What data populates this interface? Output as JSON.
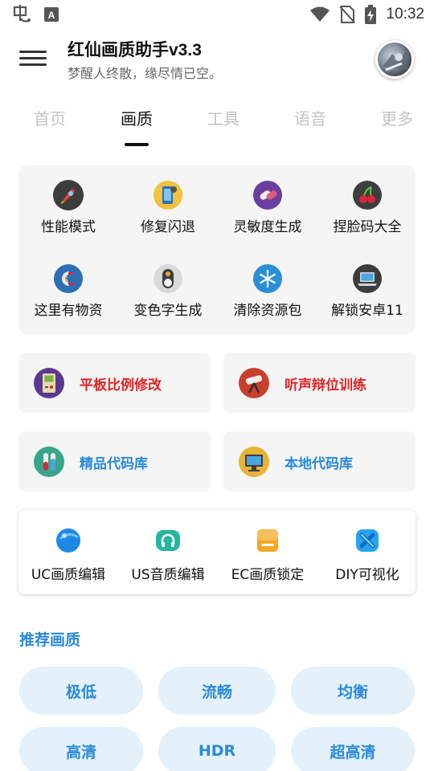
{
  "status_bar": {
    "time": "10:32",
    "icons": [
      "app-notification-icon",
      "font-notification-icon",
      "wifi-icon",
      "no-sim-icon",
      "battery-charging-icon"
    ]
  },
  "header": {
    "title": "红仙画质助手v3.3",
    "subtitle": "梦醒人终散，缘尽情已空。"
  },
  "tabs": [
    {
      "label": "首页",
      "active": false
    },
    {
      "label": "画质",
      "active": true
    },
    {
      "label": "工具",
      "active": false
    },
    {
      "label": "语音",
      "active": false
    },
    {
      "label": "更多",
      "active": false
    }
  ],
  "grid": [
    {
      "label": "性能模式",
      "icon": "rocket-icon"
    },
    {
      "label": "修复闪退",
      "icon": "phone-repair-icon"
    },
    {
      "label": "灵敏度生成",
      "icon": "pills-icon"
    },
    {
      "label": "捏脸码大全",
      "icon": "cherry-icon"
    },
    {
      "label": "这里有物资",
      "icon": "money-magnet-icon"
    },
    {
      "label": "变色字生成",
      "icon": "toggle-icon"
    },
    {
      "label": "清除资源包",
      "icon": "snowflake-icon"
    },
    {
      "label": "解锁安卓11",
      "icon": "laptop-icon"
    }
  ],
  "features": [
    {
      "label": "平板比例修改",
      "icon": "gameboy-icon",
      "color": "#e02424"
    },
    {
      "label": "听声辩位训练",
      "icon": "telescope-icon",
      "color": "#e02424"
    },
    {
      "label": "精品代码库",
      "icon": "test-tubes-icon",
      "color": "#2a8ad8"
    },
    {
      "label": "本地代码库",
      "icon": "monitor-icon",
      "color": "#2a8ad8"
    }
  ],
  "editors": [
    {
      "label": "UC画质编辑",
      "icon": "blue-ball-icon"
    },
    {
      "label": "US音质编辑",
      "icon": "headphone-icon"
    },
    {
      "label": "EC画质锁定",
      "icon": "document-icon"
    },
    {
      "label": "DIY可视化",
      "icon": "x-shape-icon"
    }
  ],
  "recommended": {
    "title": "推荐画质",
    "options": [
      "极低",
      "流畅",
      "均衡",
      "高清",
      "HDR",
      "超高清"
    ]
  },
  "colors": {
    "accent_blue": "#2a8ad8",
    "accent_red": "#e02424",
    "card_bg": "#f5f5f5",
    "pill_bg": "#e4f1fb"
  }
}
